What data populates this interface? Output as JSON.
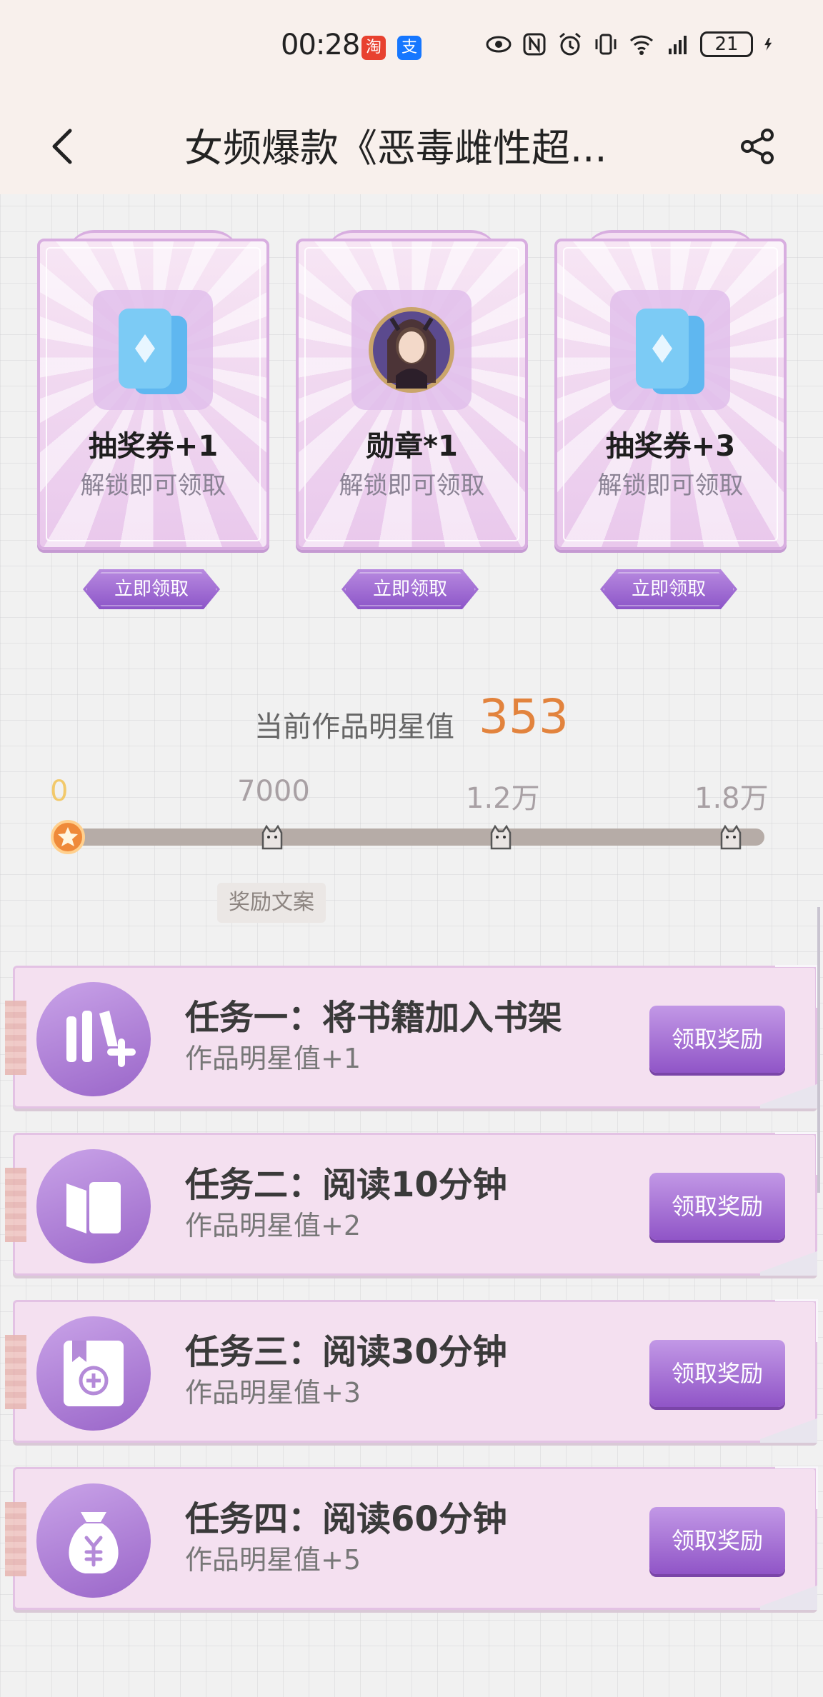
{
  "status_bar": {
    "time": "00:28",
    "badges": [
      "淘",
      "支"
    ],
    "battery": "21"
  },
  "nav": {
    "title": "女频爆款《恶毒雌性超..."
  },
  "rewards": [
    {
      "title": "抽奖券+1",
      "subtitle": "解锁即可领取",
      "button": "立即领取",
      "icon": "ticket-icon"
    },
    {
      "title": "勋章*1",
      "subtitle": "解锁即可领取",
      "button": "立即领取",
      "icon": "medal-avatar-icon"
    },
    {
      "title": "抽奖券+3",
      "subtitle": "解锁即可领取",
      "button": "立即领取",
      "icon": "ticket-icon"
    }
  ],
  "progress": {
    "label": "当前作品明星值",
    "value": "353",
    "ticks": [
      "0",
      "7000",
      "1.2万",
      "1.8万"
    ],
    "reward_note": "奖励文案"
  },
  "tasks": [
    {
      "title": "任务一：将书籍加入书架",
      "subtitle": "作品明星值+1",
      "button": "领取奖励",
      "icon": "add-to-shelf-icon"
    },
    {
      "title": "任务二：阅读10分钟",
      "subtitle": "作品明星值+2",
      "button": "领取奖励",
      "icon": "book-icon"
    },
    {
      "title": "任务三：阅读30分钟",
      "subtitle": "作品明星值+3",
      "button": "领取奖励",
      "icon": "bookmark-add-icon"
    },
    {
      "title": "任务四：阅读60分钟",
      "subtitle": "作品明星值+5",
      "button": "领取奖励",
      "icon": "money-bag-icon"
    }
  ],
  "colors": {
    "accent_purple": "#9055c7",
    "star_value_orange": "#e2833d",
    "header_bg": "#f8f0ec"
  }
}
